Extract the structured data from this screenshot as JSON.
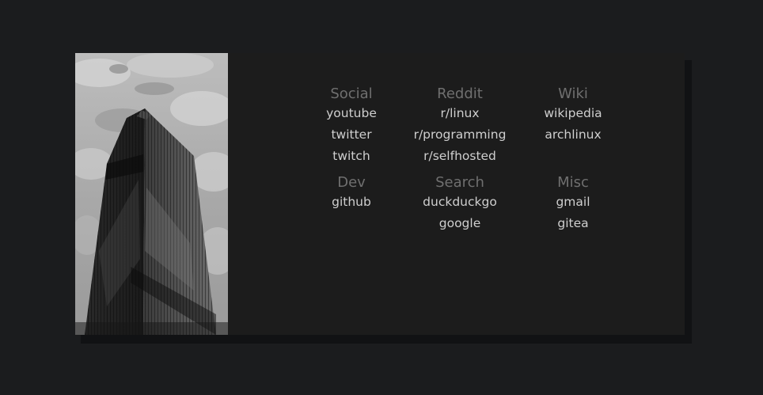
{
  "groups": [
    {
      "title": "Social",
      "links": [
        "youtube",
        "twitter",
        "twitch"
      ]
    },
    {
      "title": "Reddit",
      "links": [
        "r/linux",
        "r/programming",
        "r/selfhosted"
      ]
    },
    {
      "title": "Wiki",
      "links": [
        "wikipedia",
        "archlinux"
      ]
    },
    {
      "title": "Dev",
      "links": [
        "github"
      ]
    },
    {
      "title": "Search",
      "links": [
        "duckduckgo",
        "google"
      ]
    },
    {
      "title": "Misc",
      "links": [
        "gmail",
        "gitea"
      ]
    }
  ],
  "colors": {
    "background": "#1b1c1e",
    "card": "#1c1c1c",
    "shadow": "#111214",
    "heading": "#6f6f6f",
    "link": "#cfcfcf"
  },
  "image": {
    "icon": "skyscraper-photo"
  }
}
